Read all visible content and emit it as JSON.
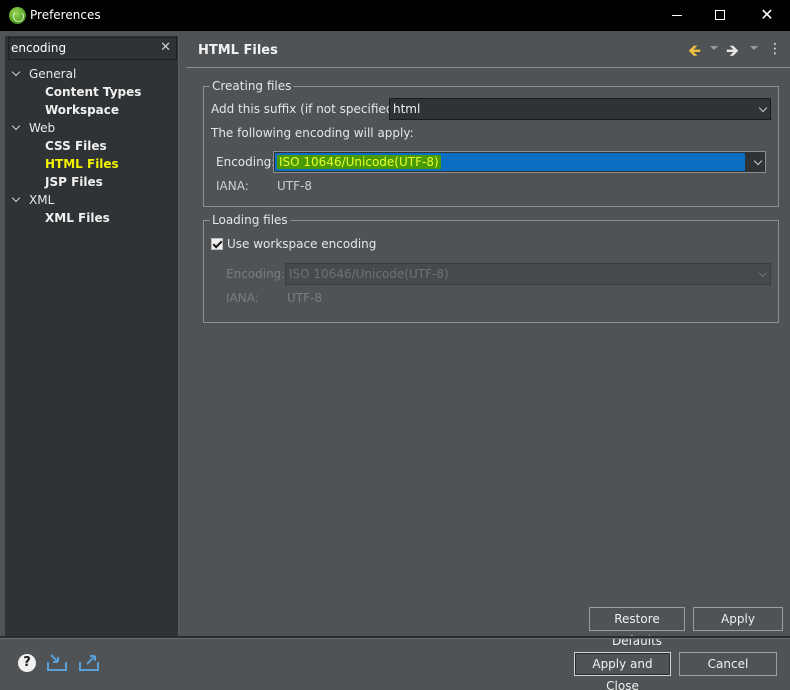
{
  "window": {
    "title": "Preferences",
    "close_glyph": "✕"
  },
  "filter": {
    "value": "encoding",
    "clear_glyph": "✕"
  },
  "tree": [
    {
      "label": "General",
      "level": 0,
      "expanded": true
    },
    {
      "label": "Content Types",
      "level": 1
    },
    {
      "label": "Workspace",
      "level": 1
    },
    {
      "label": "Web",
      "level": 0,
      "expanded": true
    },
    {
      "label": "CSS Files",
      "level": 1
    },
    {
      "label": "HTML Files",
      "level": 1,
      "selected": true
    },
    {
      "label": "JSP Files",
      "level": 1
    },
    {
      "label": "XML",
      "level": 0,
      "expanded": true
    },
    {
      "label": "XML Files",
      "level": 1
    }
  ],
  "page": {
    "title": "HTML Files",
    "nav_back_glyph": "🡸",
    "nav_forward_glyph": "🡺",
    "menu_glyph": "⋮"
  },
  "creating_files": {
    "legend": "Creating files",
    "suffix_label": "Add this suffix (if not specified):",
    "suffix_value": "html",
    "following_label": "The following encoding will apply:",
    "encoding_label": "Encoding:",
    "encoding_value": "ISO 10646/Unicode(UTF-8)",
    "iana_label": "IANA:",
    "iana_value": "UTF-8"
  },
  "loading_files": {
    "legend": "Loading files",
    "use_workspace_label": "Use workspace encoding",
    "use_workspace_checked": true,
    "encoding_label": "Encoding:",
    "encoding_value": "ISO 10646/Unicode(UTF-8)",
    "iana_label": "IANA:",
    "iana_value": "UTF-8"
  },
  "buttons": {
    "restore_defaults": "Restore Defaults",
    "apply": "Apply",
    "apply_and_close": "Apply and Close",
    "cancel": "Cancel"
  },
  "icons": {
    "help": "help-icon",
    "import": "import-icon",
    "export": "export-icon"
  },
  "colors": {
    "background": "#4f5355",
    "panel": "#2f3335",
    "selection": "#0a6fc2",
    "highlight_text": "#f2f200",
    "highlight_bg": "#4a9a06"
  }
}
